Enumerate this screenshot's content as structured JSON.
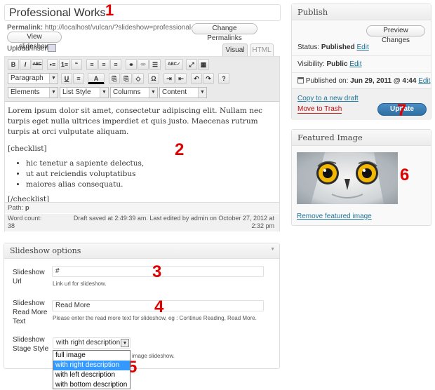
{
  "post": {
    "title": "Professional Works",
    "permalink_label": "Permalink:",
    "permalink_url": "http://localhost/vulcan/?slideshow=professional-works",
    "change_permalinks": "Change Permalinks",
    "view_slideshow": "View slideshow",
    "upload_insert": "Upload/Insert"
  },
  "editor": {
    "tabs": [
      "Visual",
      "HTML"
    ],
    "toolbar_row1": [
      "B",
      "I",
      "ABC",
      "•≡",
      "1≡",
      "“",
      "≡",
      "≡",
      "≡",
      "⚭",
      "⚮",
      "☰",
      "ABC✓",
      "⤢",
      "▦"
    ],
    "format_select": "Paragraph",
    "toolbar_row2": [
      "U",
      "≡",
      "A",
      "⎘",
      "⎘",
      "◇",
      "Ω",
      "⇥",
      "⇤",
      "↶",
      "↷",
      "?"
    ],
    "select_elements": "Elements",
    "select_liststyle": "List Style",
    "select_columns": "Columns",
    "select_content": "Content",
    "paragraph": "Lorem ipsum dolor sit amet, consectetur adipiscing elit. Nullam nec turpis eget nulla ultrices imperdiet et quis justo. Maecenas rutrum turpis at orci vulputate aliquam.",
    "shortcode_open": "[checklist]",
    "list_items": [
      "hic tenetur a sapiente delectus,",
      "ut aut reiciendis voluptatibus",
      "maiores alias consequatu."
    ],
    "shortcode_close": "[/checklist]",
    "path_label": "Path:",
    "path_value": "p",
    "word_count_label": "Word count:",
    "word_count": "38",
    "draft_status": "Draft saved at 2:49:39 am. Last edited by admin on October 27, 2012 at 2:32 pm"
  },
  "publish": {
    "title": "Publish",
    "preview": "Preview Changes",
    "status_label": "Status:",
    "status_value": "Published",
    "visibility_label": "Visibility:",
    "visibility_value": "Public",
    "published_label": "Published on:",
    "published_value": "Jun 29, 2011 @ 4:44",
    "edit": "Edit",
    "copy_draft": "Copy to a new draft",
    "trash": "Move to Trash",
    "update": "Update"
  },
  "featured": {
    "title": "Featured Image",
    "remove": "Remove featured image"
  },
  "slideshow": {
    "title": "Slideshow options",
    "url_label": "Slideshow Url",
    "url_value": "#",
    "url_help": "Link url for slideshow.",
    "readmore_label": "Slideshow Read More Text",
    "readmore_value": "Read More",
    "readmore_help": "Please enter the read more text for slideshow, eg : Continue Reading, Read More.",
    "stage_label": "Slideshow Stage Style",
    "stage_value": "with right description",
    "stage_help": "image slideshow.",
    "stage_options": [
      "full image",
      "with right description",
      "with left description",
      "with bottom description"
    ]
  },
  "annotations": [
    "1",
    "2",
    "3",
    "4",
    "5",
    "6",
    "7"
  ],
  "colors": {
    "annotation": "#e00000",
    "link": "#21759b",
    "update_button": "#2e6fa4",
    "selected_option": "#3399ff"
  }
}
